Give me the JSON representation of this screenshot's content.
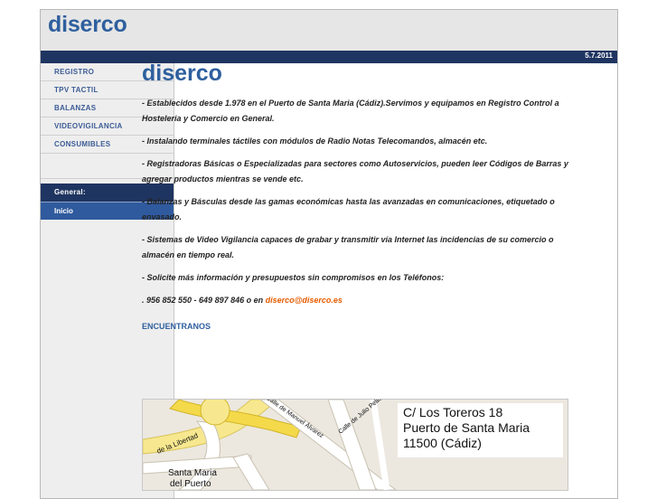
{
  "header": {
    "logo": "diserco",
    "date": "5.7.2011"
  },
  "sidebar": {
    "items": [
      {
        "label": "REGISTRO"
      },
      {
        "label": "TPV TACTIL"
      },
      {
        "label": "BALANZAS"
      },
      {
        "label": "VIDEOVIGILANCIA"
      },
      {
        "label": "CONSUMIBLES"
      }
    ],
    "section_title": "General:",
    "selected_item": "Inicio"
  },
  "main": {
    "title": "diserco",
    "paragraphs": [
      "- Establecidos desde 1.978 en el Puerto de Santa Maria (Cádiz).Servimos y equipamos en Registro Control a Hosteleria y Comercio en General.",
      "- Instalando terminales táctiles con módulos de Radio Notas Telecomandos, almacén etc.",
      "- Registradoras Básicas o Especializadas para sectores como Autoservicios, pueden leer Códigos de Barras y agregar productos mientras se vende etc.",
      "- Balanzas y Básculas desde las gamas económicas hasta las avanzadas en comunicaciones, etiquetado o envasado.",
      "- Sistemas de Video Vigilancia capaces de grabar y transmitir vía Internet las incidencias de su comercio o almacén en tiempo real.",
      "- Solicite más información y presupuestos sin compromisos en los Teléfonos:"
    ],
    "phones": ". 956 852 550 - 649 897 846 o en ",
    "email": "diserco@diserco.es",
    "section_heading": "ENCUENTRANOS"
  },
  "map": {
    "address_line1": "C/ Los Toreros 18",
    "address_line2": "Puerto de Santa Maria",
    "address_line3": "11500 (Cádiz)",
    "place_label_1": "Santa Maria",
    "place_label_2": "del Puerto",
    "street_1": "Calle de Manuel Álvarez",
    "street_2": "Calle de Julio Pellicer",
    "street_3": "de la Libertad"
  }
}
